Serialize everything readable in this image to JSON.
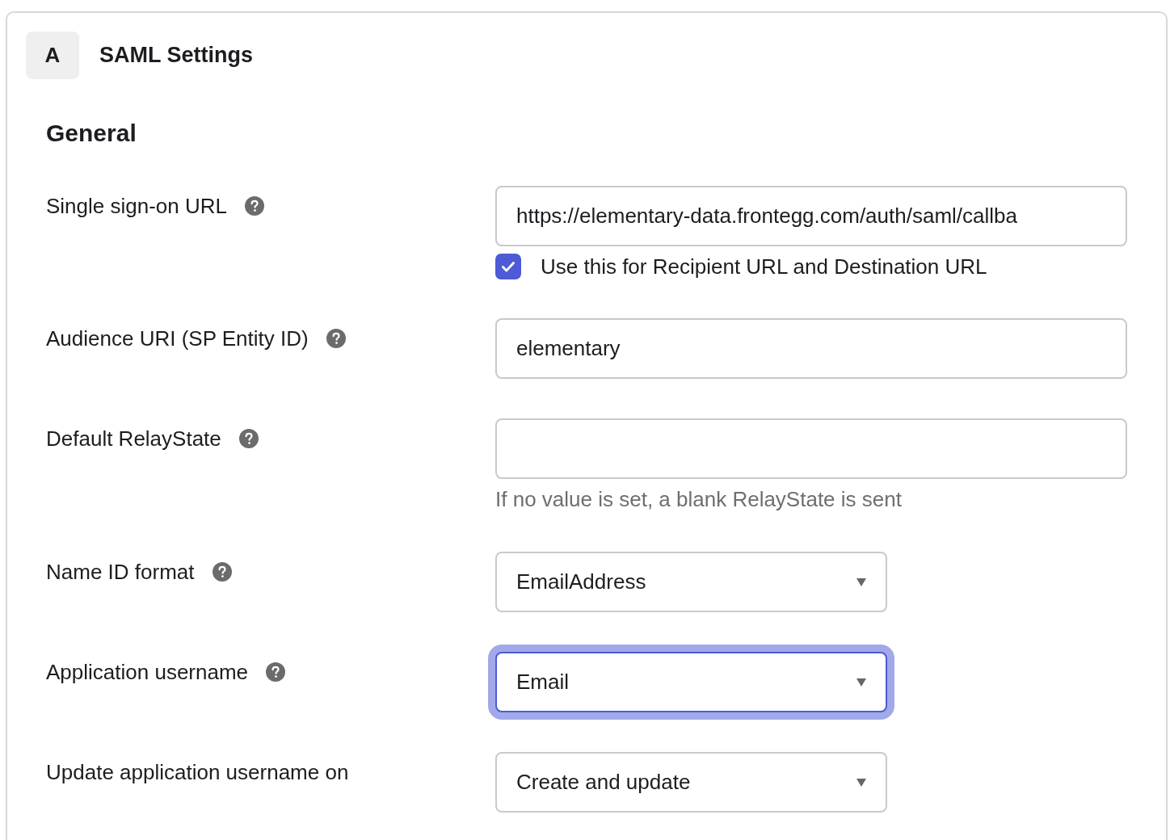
{
  "step": {
    "badge": "A",
    "title": "SAML Settings"
  },
  "section": {
    "heading": "General"
  },
  "fields": [
    {
      "kind": "text",
      "label": "Single sign-on URL",
      "help": true,
      "value": "https://elementary-data.frontegg.com/auth/saml/callba",
      "focused": false,
      "checkbox": {
        "label": "Use this for Recipient URL and Destination URL",
        "checked": true
      }
    },
    {
      "kind": "text",
      "label": "Audience URI (SP Entity ID)",
      "help": true,
      "value": "elementary",
      "focused": false
    },
    {
      "kind": "text",
      "label": "Default RelayState",
      "help": true,
      "focused": false,
      "hint": "If no value is set, a blank RelayState is sent"
    },
    {
      "kind": "select",
      "label": "Name ID format",
      "help": true,
      "value": "EmailAddress",
      "focused": false
    },
    {
      "kind": "select",
      "label": "Application username",
      "help": true,
      "value": "Email",
      "focused": true
    },
    {
      "kind": "select",
      "label": "Update application username on",
      "help": false,
      "value": "Create and update",
      "focused": false
    }
  ]
}
